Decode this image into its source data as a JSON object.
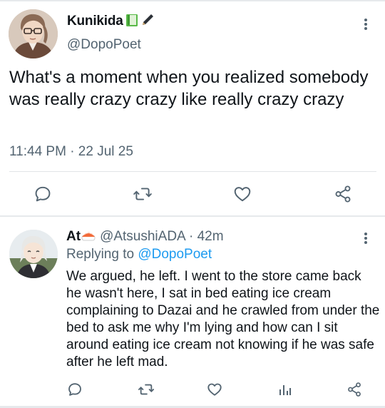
{
  "tweet": {
    "display_name": "Kunikida",
    "name_emojis": [
      "green-book-emoji",
      "pen-emoji"
    ],
    "handle": "@DopoPoet",
    "text": "What's a moment when you realized somebody was really crazy crazy like really crazy crazy",
    "timestamp": "11:44 PM · 22 Jul 25",
    "actions": [
      "reply-icon",
      "retweet-icon",
      "like-icon",
      "share-icon"
    ]
  },
  "reply": {
    "display_name": "At",
    "name_emoji": "sushi-emoji",
    "handle": "@AtsushiADA",
    "age": "· 42m",
    "replying_to_prefix": "Replying to ",
    "replying_to_handle": "@DopoPoet",
    "text": "We argued, he left. I went to the store came back he wasn't here, I sat in bed eating ice cream complaining to Dazai and he crawled from under the bed to ask me why I'm lying and how can I sit around eating ice cream not knowing if he was safe after he left mad.",
    "actions": [
      "reply-icon",
      "retweet-icon",
      "like-icon",
      "analytics-icon",
      "share-icon"
    ]
  },
  "colors": {
    "text": "#0f1419",
    "secondary": "#536471",
    "link": "#1d9bf0",
    "divider": "#e6e9ec"
  }
}
